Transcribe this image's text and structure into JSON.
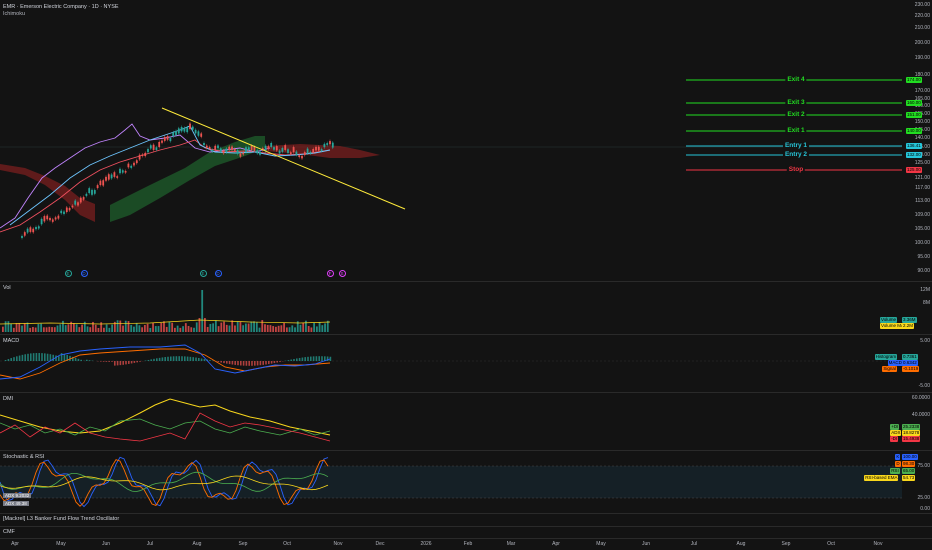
{
  "header": {
    "title": "EMR · Emerson Electric Company · 1D · NYSE",
    "indicator": "Ichimoku"
  },
  "price_scale": [
    "230.00",
    "220.00",
    "210.00",
    "200.00",
    "190.00",
    "180.00",
    "170.00",
    "165.00",
    "160.00",
    "155.00",
    "150.00",
    "145.00",
    "140.00",
    "135.00",
    "130.00",
    "125.00",
    "121.00",
    "117.00",
    "113.00",
    "109.00",
    "105.00",
    "100.00",
    "95.00",
    "90.00",
    "85.00"
  ],
  "levels": [
    {
      "label": "Exit 4",
      "tag": "174.00",
      "color": "#22dd22"
    },
    {
      "label": "Exit 3",
      "tag": "160.00",
      "color": "#22dd22"
    },
    {
      "label": "Exit 2",
      "tag": "151.00",
      "color": "#22dd22"
    },
    {
      "label": "Exit 1",
      "tag": "140.00",
      "color": "#22dd22"
    },
    {
      "label": "Entry 1",
      "tag": "136.41",
      "color": "#26c6da"
    },
    {
      "label": "Entry 2",
      "tag": "132.00",
      "color": "#26c6da"
    },
    {
      "label": "Stop",
      "tag": "125.00",
      "color": "#f23645"
    }
  ],
  "events": [
    {
      "symbol": "E",
      "color": "#26a69a"
    },
    {
      "symbol": "D",
      "color": "#2962ff"
    },
    {
      "symbol": "E",
      "color": "#26a69a"
    },
    {
      "symbol": "D",
      "color": "#2962ff"
    },
    {
      "symbol": "F",
      "color": "#e040fb"
    },
    {
      "symbol": "S",
      "color": "#e040fb"
    }
  ],
  "volume": {
    "title": "Vol",
    "scale": [
      "12M",
      "8M"
    ],
    "tags": [
      {
        "label": "Volume",
        "value": "3.36M",
        "color": "#26a69a"
      },
      {
        "label": "Volume MA",
        "value": "2.2M",
        "color": "#f9d71c"
      }
    ]
  },
  "macd": {
    "title": "MACD",
    "scale": [
      "5.00",
      "-5.00"
    ],
    "tags": [
      {
        "label": "Histogram",
        "value": "0.7361",
        "color": "#26a69a"
      },
      {
        "label": "MACD",
        "value": "0.6342",
        "color": "#2962ff"
      },
      {
        "label": "Signal",
        "value": "-0.1019",
        "color": "#ff6d00"
      }
    ]
  },
  "dmi": {
    "title": "DMI",
    "scale": [
      "60.0000",
      "40.0000"
    ],
    "tags": [
      {
        "label": "+DI",
        "value": "25.2338",
        "color": "#4caf50"
      },
      {
        "label": "ADX",
        "value": "18.8278",
        "color": "#f9d71c"
      },
      {
        "label": "-DI",
        "value": "15.4938",
        "color": "#f23645"
      }
    ]
  },
  "stoch": {
    "title": "Stochastic & RSI",
    "scale": [
      "75.00",
      "25.00",
      "0.00"
    ],
    "tags": [
      {
        "label": "K",
        "value": "100.00",
        "color": "#2962ff"
      },
      {
        "label": "D",
        "value": "98.30",
        "color": "#ff6d00"
      },
      {
        "label": "RSI",
        "value": "65.00",
        "color": "#4caf50"
      },
      {
        "label": "RSI-based EMA",
        "value": "54.73",
        "color": "#f9d71c"
      }
    ],
    "overlay_labels": [
      "ADX 9.2032",
      "ADX 49.38"
    ]
  },
  "banker": {
    "title": "[Mackrel] L3 Banker Fund Flow Trend Oscillator"
  },
  "cmf": {
    "title": "CMF"
  },
  "time_axis": [
    "Apr",
    "May",
    "Jun",
    "Jul",
    "Aug",
    "Sep",
    "Oct",
    "Nov",
    "Dec",
    "2026",
    "Feb",
    "Mar",
    "Apr",
    "May",
    "Jun",
    "Jul",
    "Aug",
    "Sep",
    "Oct",
    "Nov"
  ]
}
